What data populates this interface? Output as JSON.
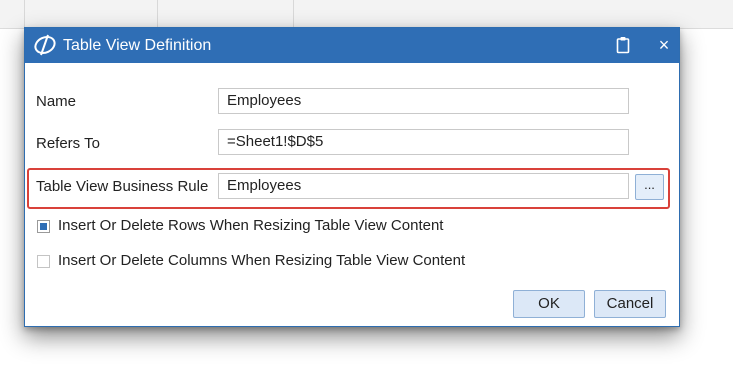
{
  "dialog": {
    "title": "Table View Definition",
    "icons": {
      "app": "app-logo-icon",
      "clipboard": "clipboard-icon",
      "close": "close-icon"
    },
    "close_glyph": "×"
  },
  "form": {
    "name_label": "Name",
    "name_value": "Employees",
    "refers_to_label": "Refers To",
    "refers_to_value": "=Sheet1!$D$5",
    "business_rule_label": "Table View Business Rule",
    "business_rule_value": "Employees",
    "browse_label": "..."
  },
  "options": {
    "insert_delete_rows": {
      "label": "Insert Or Delete Rows When Resizing Table View Content",
      "checked": true
    },
    "insert_delete_columns": {
      "label": "Insert Or Delete Columns When Resizing Table View Content",
      "checked": false
    }
  },
  "buttons": {
    "ok": "OK",
    "cancel": "Cancel"
  },
  "colors": {
    "titlebar": "#2f6eb5",
    "highlight": "#d9413a",
    "button_bg": "#dce8f7"
  }
}
